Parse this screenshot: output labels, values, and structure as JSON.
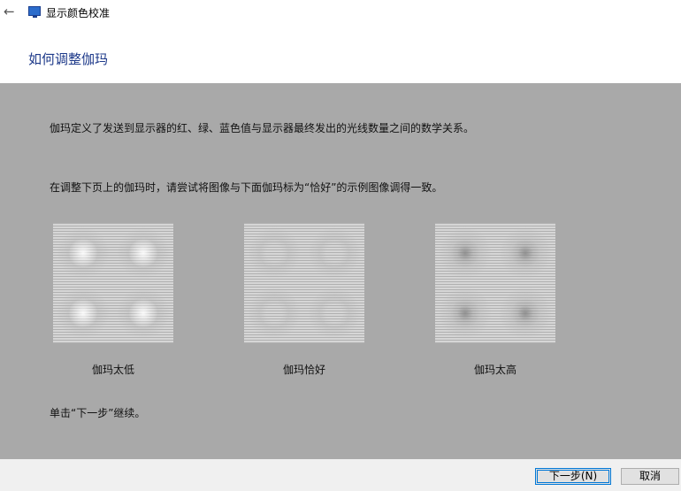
{
  "window": {
    "title": "显示颜色校准",
    "back_glyph": "←"
  },
  "page": {
    "heading": "如何调整伽玛",
    "description": "伽玛定义了发送到显示器的红、绿、蓝色值与显示器最终发出的光线数量之间的数学关系。",
    "instruction": "在调整下页上的伽玛时，请尝试将图像与下面伽玛标为“恰好”的示例图像调得一致。",
    "continue_hint": "单击“下一步”继续。"
  },
  "samples": [
    {
      "caption": "伽玛太低",
      "dot_color": "#ffffff",
      "dot_strength": 0.9
    },
    {
      "caption": "伽玛恰好",
      "dot_color": "#b4b4b4",
      "dot_strength": 0.0
    },
    {
      "caption": "伽玛太高",
      "dot_color": "#8a8a8a",
      "dot_strength": 0.9
    }
  ],
  "footer": {
    "next_label": "下一步(N)",
    "cancel_label": "取消"
  },
  "colors": {
    "background": "#a9a9a9",
    "heading": "#1e3a8a",
    "button_focus": "#0078d7"
  }
}
